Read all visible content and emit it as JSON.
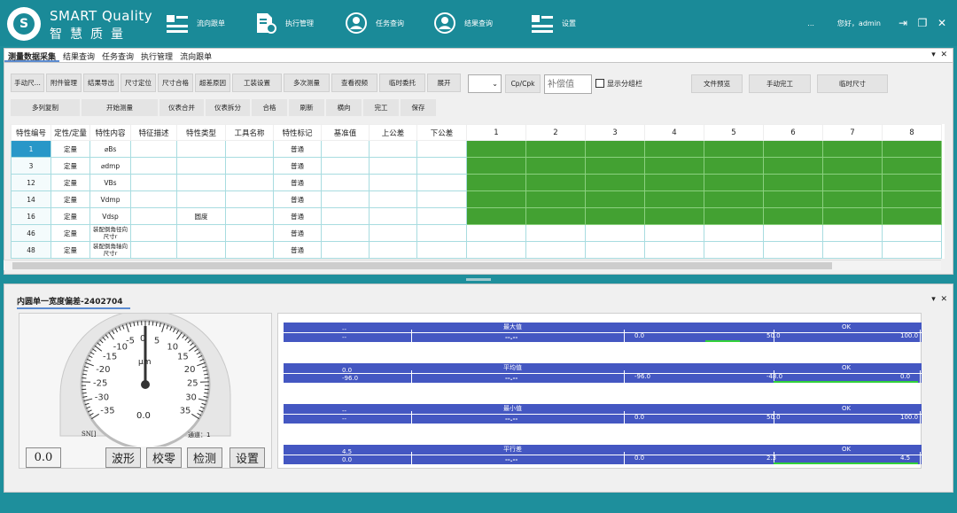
{
  "app": {
    "name_en": "SMART Quality",
    "name_cn": "智慧质量",
    "logo_letter": "S"
  },
  "nav": [
    {
      "label": "流向跟单",
      "icon": "list-icon"
    },
    {
      "label": "执行管理",
      "icon": "document-gear-icon"
    },
    {
      "label": "任务查询",
      "icon": "user-circle-icon"
    },
    {
      "label": "结果查询",
      "icon": "user-circle-icon"
    },
    {
      "label": "设置",
      "icon": "list-icon"
    }
  ],
  "header": {
    "more": "...",
    "greeting": "您好，admin"
  },
  "tabs": [
    "测量数据采集",
    "结果查询",
    "任务查询",
    "执行管理",
    "流向跟单"
  ],
  "toolbar_row1": [
    {
      "label": "手动尺..."
    },
    {
      "label": "附件管理"
    },
    {
      "label": "结果导出"
    },
    {
      "label": "尺寸定位"
    },
    {
      "label": "尺寸合格"
    },
    {
      "label": "超差原因"
    },
    {
      "label": "工装设置"
    },
    {
      "label": "多次测量"
    },
    {
      "label": "查看视频"
    },
    {
      "label": "临时委托"
    },
    {
      "label": "展开"
    }
  ],
  "toolbar_row1b": {
    "cpk": "Cp/Cpk",
    "comp_placeholder": "补偿值",
    "show_group": "显示分组栏",
    "file_preview": "文件预览",
    "manual_finish": "手动完工",
    "temp_size": "临时尺寸"
  },
  "toolbar_row2": [
    "多列复制",
    "开始测量",
    "仪表合并",
    "仪表拆分",
    "合格",
    "刷新",
    "横向",
    "完工",
    "保存"
  ],
  "table": {
    "headers": [
      "特性编号",
      "定性/定量",
      "特性内容",
      "特征描述",
      "特性类型",
      "工具名称",
      "特性标记",
      "基准值",
      "上公差",
      "下公差",
      "1",
      "2",
      "3",
      "4",
      "5",
      "6",
      "7",
      "8"
    ],
    "rows": [
      {
        "id": "1",
        "qual": "定量",
        "content": "⌀Bs",
        "desc": "",
        "type": "",
        "tool": "",
        "mark": "普通"
      },
      {
        "id": "3",
        "qual": "定量",
        "content": "⌀dmp",
        "desc": "",
        "type": "",
        "tool": "",
        "mark": "普通"
      },
      {
        "id": "12",
        "qual": "定量",
        "content": "VBs",
        "desc": "",
        "type": "",
        "tool": "",
        "mark": "普通"
      },
      {
        "id": "14",
        "qual": "定量",
        "content": "Vdmp",
        "desc": "",
        "type": "",
        "tool": "",
        "mark": "普通"
      },
      {
        "id": "16",
        "qual": "定量",
        "content": "Vdsp",
        "desc": "",
        "type": "圆度",
        "tool": "",
        "mark": "普通"
      },
      {
        "id": "46",
        "qual": "定量",
        "content": "装配倒角径向尺寸r",
        "desc": "",
        "type": "",
        "tool": "",
        "mark": "普通"
      },
      {
        "id": "48",
        "qual": "定量",
        "content": "装配倒角轴向尺寸r",
        "desc": "",
        "type": "",
        "tool": "",
        "mark": "普通"
      }
    ]
  },
  "panel2": {
    "title": "内圆单一宽度偏差-2402704"
  },
  "gauge": {
    "ticks_left": [
      "-5",
      "-10",
      "-15",
      "-20",
      "-25",
      "-30",
      "-35"
    ],
    "ticks_right": [
      "0",
      "5",
      "10",
      "15",
      "20",
      "25",
      "30",
      "35"
    ],
    "unit": "μm",
    "value": "0.0",
    "sn": "SN[]",
    "channel": "通道：1"
  },
  "gauge_buttons": {
    "value": "0.0",
    "wave": "波形",
    "zero": "校零",
    "detect": "检测",
    "setup": "设置"
  },
  "bars": [
    {
      "name": "最大值",
      "status": "OK",
      "left_top": "--",
      "left_bot": "--",
      "mid": "--.--",
      "a": "0.0",
      "b": "50.0",
      "c": "100.0",
      "fill": 0.5
    },
    {
      "name": "平均值",
      "status": "OK",
      "left_top": "0.0",
      "left_bot": "-96.0",
      "mid": "--.--",
      "a": "-96.0",
      "b": "-48.0",
      "c": "0.0",
      "fill": 0.99
    },
    {
      "name": "最小值",
      "status": "OK",
      "left_top": "--",
      "left_bot": "--",
      "mid": "--.--",
      "a": "0.0",
      "b": "50.0",
      "c": "100.0",
      "fill": 0.0
    },
    {
      "name": "平行差",
      "status": "OK",
      "left_top": "4.5",
      "left_bot": "0.0",
      "mid": "--.--",
      "a": "0.0",
      "b": "2.3",
      "c": "4.5",
      "fill": 0.99
    }
  ],
  "colors": {
    "accent": "#1a8a98",
    "selected": "#2897c8",
    "green": "#43a132",
    "bar": "#4457c2"
  }
}
